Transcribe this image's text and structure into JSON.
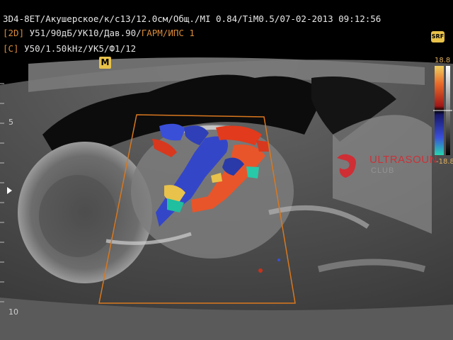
{
  "header": {
    "main_line": "3D4-8ET/Акушерское/к/c13/12.0см/Общ./MI 0.84/TiМ0.5/07-02-2013 09:12:56",
    "mode_2d": {
      "tag": "[2D]",
      "params": "У51/90дБ/УК10/Дав.90/",
      "harmonic": "ГАРМ/ИПС 1"
    },
    "mode_c": {
      "tag": "[C]",
      "params": "У50/1.50kHz/УК5/Ф1/12"
    }
  },
  "badges": {
    "m": "M",
    "srf": "SRF"
  },
  "depth_scale": {
    "mark_5": "5",
    "mark_10": "10"
  },
  "color_scale": {
    "top_value": "18.8",
    "bottom_value": "-18.8"
  },
  "watermark": {
    "line1": "ULTRASOUN",
    "line2": "CLUB"
  },
  "colors": {
    "header_text": "#e8e8e8",
    "mode_accent": "#d98a3a",
    "badge_yellow": "#e8c24a",
    "roi_outline": "#d9781e",
    "doppler_red": "#e23a1c",
    "doppler_blue": "#3a4fd8",
    "watermark_red": "#d8262e"
  },
  "icons": [
    "focus-marker-icon",
    "ultrasound-club-logo-icon"
  ]
}
